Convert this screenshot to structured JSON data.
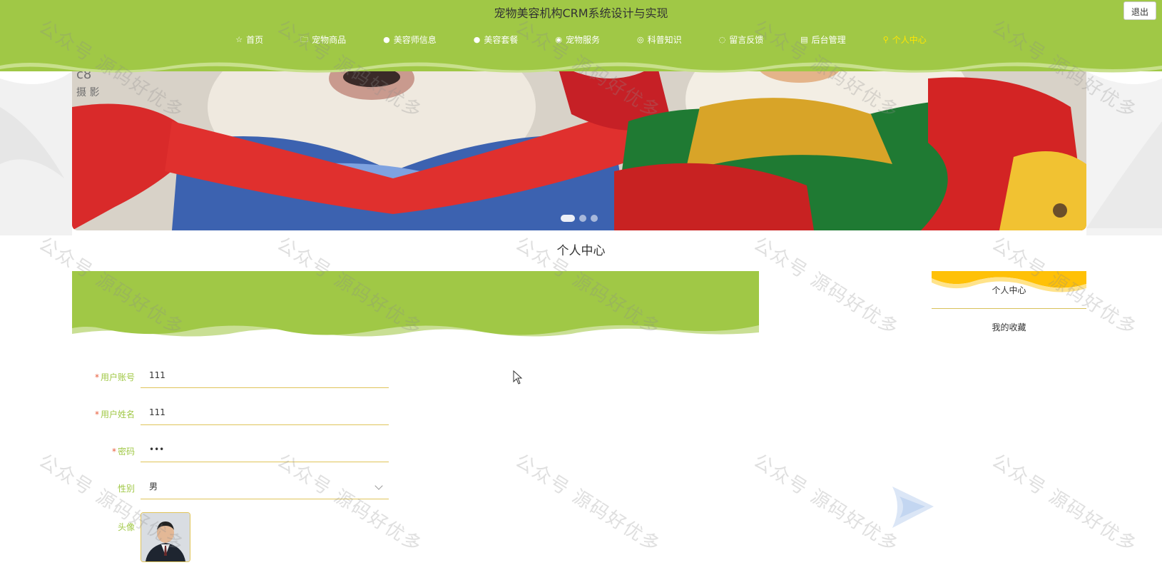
{
  "header": {
    "title": "宠物美容机构CRM系统设计与实现",
    "logout_label": "退出"
  },
  "nav": {
    "items": [
      {
        "label": "首页",
        "icon": "star-icon"
      },
      {
        "label": "宠物商品",
        "icon": "bag-icon"
      },
      {
        "label": "美容师信息",
        "icon": "info-icon"
      },
      {
        "label": "美容套餐",
        "icon": "question-icon"
      },
      {
        "label": "宠物服务",
        "icon": "compass-icon"
      },
      {
        "label": "科普知识",
        "icon": "globe-icon"
      },
      {
        "label": "留言反馈",
        "icon": "chat-icon"
      },
      {
        "label": "后台管理",
        "icon": "doc-icon"
      },
      {
        "label": "个人中心",
        "icon": "user-icon",
        "active": true
      }
    ]
  },
  "banner": {
    "slide_count": 3,
    "active_index": 0
  },
  "page": {
    "title": "个人中心"
  },
  "sidebar": {
    "items": [
      {
        "label": "个人中心",
        "active": true
      },
      {
        "label": "我的收藏"
      }
    ]
  },
  "form": {
    "account": {
      "label": "用户账号",
      "value": "111",
      "required": true
    },
    "name": {
      "label": "用户姓名",
      "value": "111",
      "required": true
    },
    "password": {
      "label": "密码",
      "value": "•••",
      "required": true
    },
    "gender": {
      "label": "性别",
      "value": "男"
    },
    "avatar": {
      "label": "头像"
    }
  },
  "watermark": {
    "text": "公众号 源码好优多"
  },
  "colors": {
    "brand_green": "#a0c846",
    "accent_yellow": "#ffc107",
    "active_nav": "#ffe600",
    "required_star": "#e85c3a"
  }
}
